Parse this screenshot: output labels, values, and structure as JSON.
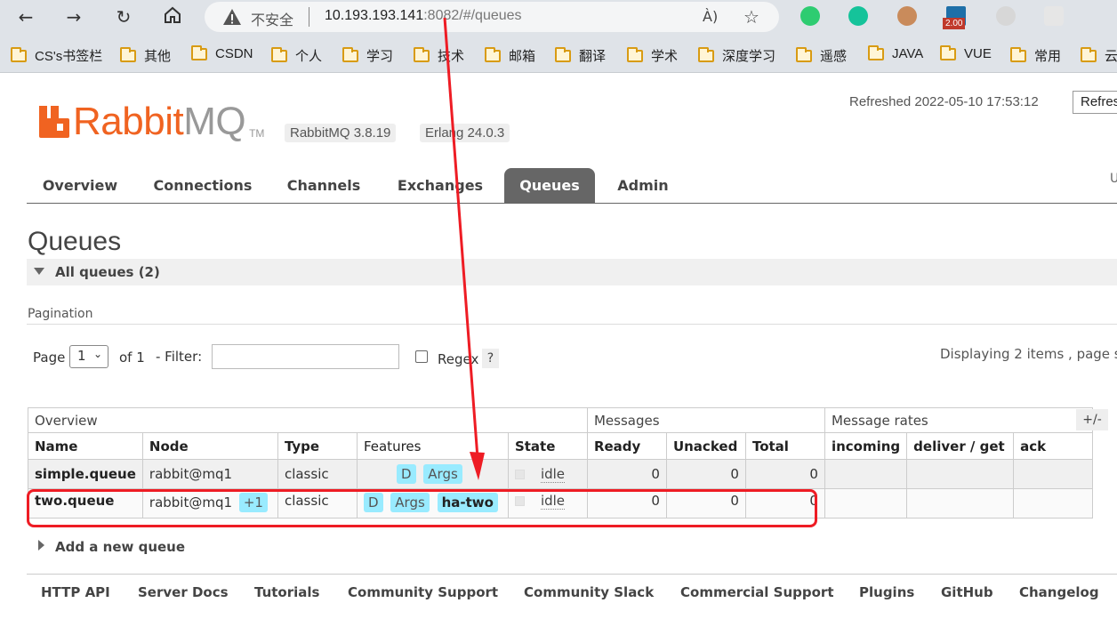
{
  "browser": {
    "insecure_label": "不安全",
    "url_host": "10.193.193.141",
    "url_rest": ":8082/#/queues",
    "read_aloud": "Á)",
    "ext_badge": "2.00",
    "bookmarks": [
      "CS's书签栏",
      "其他",
      "CSDN",
      "个人",
      "学习",
      "技术",
      "邮箱",
      "翻译",
      "学术",
      "深度学习",
      "遥感",
      "JAVA",
      "VUE",
      "常用",
      "云"
    ]
  },
  "header": {
    "logo_rabbit": "Rabbit",
    "logo_mq": "MQ",
    "logo_tm": "TM",
    "rabbitmq_version": "RabbitMQ 3.8.19",
    "erlang_version": "Erlang 24.0.3",
    "refreshed": "Refreshed 2022-05-10 17:53:12",
    "refresh_button": "Refres",
    "user_hint": "U"
  },
  "tabs": [
    "Overview",
    "Connections",
    "Channels",
    "Exchanges",
    "Queues",
    "Admin"
  ],
  "active_tab": "Queues",
  "queues_page": {
    "title": "Queues",
    "section_title": "All queues (2)",
    "pagination_label": "Pagination",
    "page_label": "Page",
    "page_value": "1",
    "of_label": "of 1",
    "filter_label": "- Filter:",
    "regex_label": "Regex",
    "help": "?",
    "displaying": "Displaying 2 items , page s",
    "plus_minus": "+/-",
    "add_queue": "Add a new queue"
  },
  "table": {
    "group_headers": {
      "overview": "Overview",
      "messages": "Messages",
      "rates": "Message rates"
    },
    "columns": [
      "Name",
      "Node",
      "Type",
      "Features",
      "State",
      "Ready",
      "Unacked",
      "Total",
      "incoming",
      "deliver / get",
      "ack"
    ],
    "rows": [
      {
        "name": "simple.queue",
        "node": "rabbit@mq1",
        "node_extra": "",
        "type": "classic",
        "features": [
          "D",
          "Args"
        ],
        "state": "idle",
        "ready": "0",
        "unacked": "0",
        "total": "0"
      },
      {
        "name": "two.queue",
        "node": "rabbit@mq1",
        "node_extra": "+1",
        "type": "classic",
        "features": [
          "D",
          "Args",
          "ha-two"
        ],
        "state": "idle",
        "ready": "0",
        "unacked": "0",
        "total": "0"
      }
    ]
  },
  "footer": [
    "HTTP API",
    "Server Docs",
    "Tutorials",
    "Community Support",
    "Community Slack",
    "Commercial Support",
    "Plugins",
    "GitHub",
    "Changelog"
  ],
  "colors": {
    "accent": "#f06321",
    "tag": "#99ebff",
    "annotation": "#ee1c24",
    "tab_active": "#666666"
  }
}
